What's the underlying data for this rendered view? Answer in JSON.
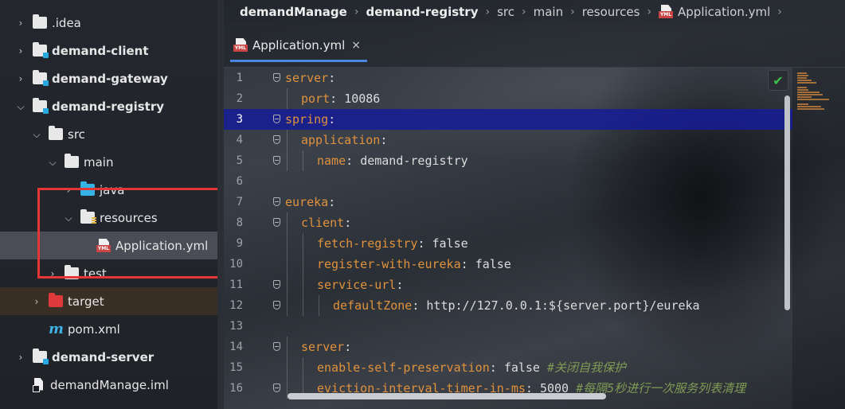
{
  "tree": {
    "items": [
      {
        "label": ".idea",
        "indent": 0,
        "arrow": "›",
        "icon": "folder",
        "bold": false
      },
      {
        "label": "demand-client",
        "indent": 0,
        "arrow": "›",
        "icon": "module-folder",
        "bold": true
      },
      {
        "label": "demand-gateway",
        "indent": 0,
        "arrow": "›",
        "icon": "module-folder",
        "bold": true
      },
      {
        "label": "demand-registry",
        "indent": 0,
        "arrow": "⌄",
        "icon": "module-folder",
        "bold": true
      },
      {
        "label": "src",
        "indent": 1,
        "arrow": "⌄",
        "icon": "folder",
        "bold": false
      },
      {
        "label": "main",
        "indent": 2,
        "arrow": "⌄",
        "icon": "folder",
        "bold": false
      },
      {
        "label": "java",
        "indent": 3,
        "arrow": "›",
        "icon": "source-folder",
        "bold": false
      },
      {
        "label": "resources",
        "indent": 3,
        "arrow": "⌄",
        "icon": "resources-folder",
        "bold": false
      },
      {
        "label": "Application.yml",
        "indent": 4,
        "arrow": "",
        "icon": "yml-file",
        "bold": false,
        "selected": true
      },
      {
        "label": "test",
        "indent": 2,
        "arrow": "›",
        "icon": "folder",
        "bold": false
      },
      {
        "label": "target",
        "indent": 1,
        "arrow": "›",
        "icon": "excluded-folder",
        "bold": false,
        "excluded": true
      },
      {
        "label": "pom.xml",
        "indent": 1,
        "arrow": "",
        "icon": "maven-file",
        "bold": false
      },
      {
        "label": "demand-server",
        "indent": 0,
        "arrow": "›",
        "icon": "module-folder",
        "bold": true
      },
      {
        "label": "demandManage.iml",
        "indent": 0,
        "arrow": "",
        "icon": "iml-file",
        "bold": false
      }
    ]
  },
  "breadcrumb": {
    "items": [
      "demandManage",
      "demand-registry",
      "src",
      "main",
      "resources",
      "Application.yml"
    ]
  },
  "tab": {
    "label": "Application.yml",
    "close": "×",
    "icon_tag": "YML"
  },
  "editor": {
    "highlight_line": 3,
    "lines": [
      {
        "n": "1",
        "key": "server",
        "sep": ":",
        "val": "",
        "comment": "",
        "indent": 0,
        "fold": true
      },
      {
        "n": "2",
        "key": "port",
        "sep": ": ",
        "val": "10086",
        "comment": "",
        "indent": 1,
        "fold": false
      },
      {
        "n": "3",
        "key": "spring",
        "sep": ":",
        "val": "",
        "comment": "",
        "indent": 0,
        "fold": true
      },
      {
        "n": "4",
        "key": "application",
        "sep": ":",
        "val": "",
        "comment": "",
        "indent": 1,
        "fold": true
      },
      {
        "n": "5",
        "key": "name",
        "sep": ": ",
        "val": "demand-registry",
        "comment": "",
        "indent": 2,
        "fold": true
      },
      {
        "n": "6",
        "key": "",
        "sep": "",
        "val": "",
        "comment": "",
        "indent": 0,
        "fold": false
      },
      {
        "n": "7",
        "key": "eureka",
        "sep": ":",
        "val": "",
        "comment": "",
        "indent": 0,
        "fold": true
      },
      {
        "n": "8",
        "key": "client",
        "sep": ":",
        "val": "",
        "comment": "",
        "indent": 1,
        "fold": true
      },
      {
        "n": "9",
        "key": "fetch-registry",
        "sep": ": ",
        "val": "false",
        "comment": "",
        "indent": 2,
        "fold": false
      },
      {
        "n": "10",
        "key": "register-with-eureka",
        "sep": ": ",
        "val": "false",
        "comment": "",
        "indent": 2,
        "fold": false
      },
      {
        "n": "11",
        "key": "service-url",
        "sep": ":",
        "val": "",
        "comment": "",
        "indent": 2,
        "fold": true
      },
      {
        "n": "12",
        "key": "defaultZone",
        "sep": ": ",
        "val": "http://127.0.0.1:${server.port}/eureka",
        "comment": "",
        "indent": 3,
        "fold": true
      },
      {
        "n": "13",
        "key": "",
        "sep": "",
        "val": "",
        "comment": "",
        "indent": 0,
        "fold": false
      },
      {
        "n": "14",
        "key": "server",
        "sep": ":",
        "val": "",
        "comment": "",
        "indent": 1,
        "fold": true
      },
      {
        "n": "15",
        "key": "enable-self-preservation",
        "sep": ": ",
        "val": "false",
        "comment": " #关闭自我保护",
        "indent": 2,
        "fold": false
      },
      {
        "n": "16",
        "key": "eviction-interval-timer-in-ms",
        "sep": ": ",
        "val": "5000",
        "comment": " #每隔5秒进行一次服务列表清理",
        "indent": 2,
        "fold": true
      }
    ]
  },
  "status": {
    "inspection_icon": "check-icon"
  },
  "colors": {
    "key": "#e0923c",
    "comment": "#7f9c55",
    "highlight": "#161c96",
    "annotation_box": "#e53535"
  }
}
